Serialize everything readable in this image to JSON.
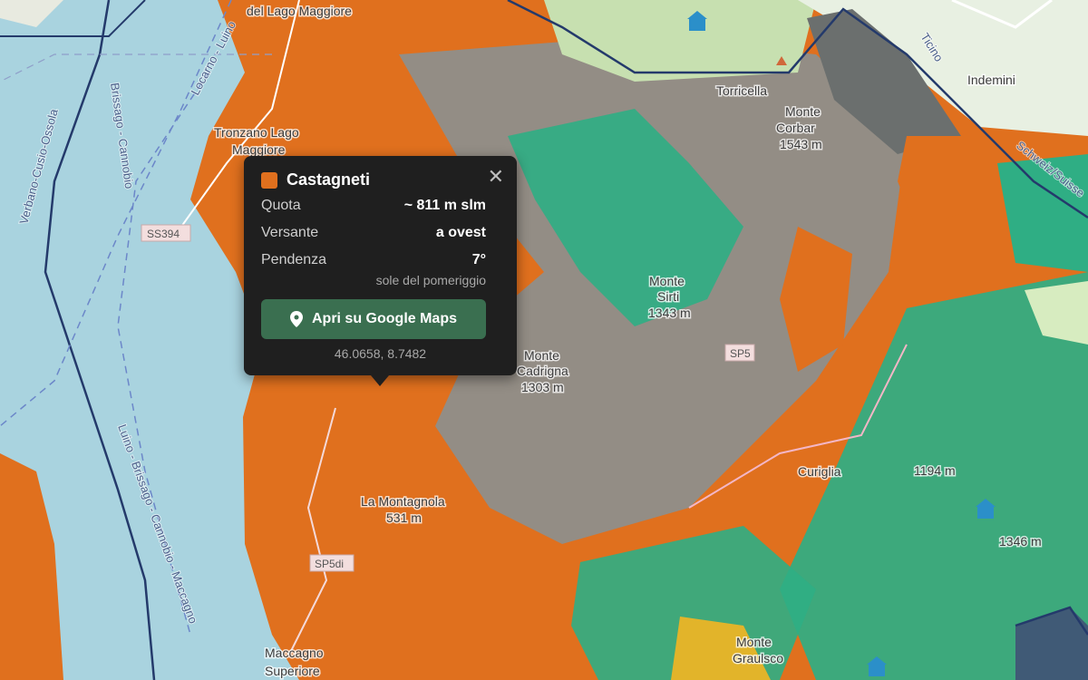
{
  "map": {
    "place_labels": [
      "del Lago Maggiore",
      "Tronzano Lago",
      "Maggiore",
      "Torricella",
      "Monte",
      "Corbar",
      "1543 m",
      "Indemini",
      "Monte",
      "Sirti",
      "1343 m",
      "Monte",
      "Cadrigna",
      "1303 m",
      "Curiglia",
      "1194 m",
      "La Montagnola",
      "531 m",
      "Maccagno",
      "Superiore",
      "Monte",
      "Graulsco",
      "1346 m"
    ],
    "road_labels": [
      "SS394",
      "SP5di",
      "SP5"
    ],
    "water_labels": [
      "Locarno - Luino",
      "Brissago - Cannobio",
      "Verbano-Cusio-Ossola",
      "Luino - Brissago - Cannobio - Maccagno",
      "Ticino",
      "Schweiz/Suisse"
    ],
    "colors": {
      "water": "#a9d3df",
      "chestnut": "#e0701e",
      "forest": "#2fae84",
      "rock": "#8c8f8e",
      "meadow": "#cfe6b6",
      "border": "#243a6b"
    }
  },
  "popup": {
    "title": "Castagneti",
    "close_icon": "close-icon",
    "rows": [
      {
        "label": "Quota",
        "value": "~ 811 m slm"
      },
      {
        "label": "Versante",
        "value": "a ovest"
      },
      {
        "label": "Pendenza",
        "value": "7°"
      }
    ],
    "note": "sole del pomeriggio",
    "button_label": "Apri su Google Maps",
    "button_icon": "map-pin-icon",
    "coordinates": "46.0658, 8.7482"
  }
}
